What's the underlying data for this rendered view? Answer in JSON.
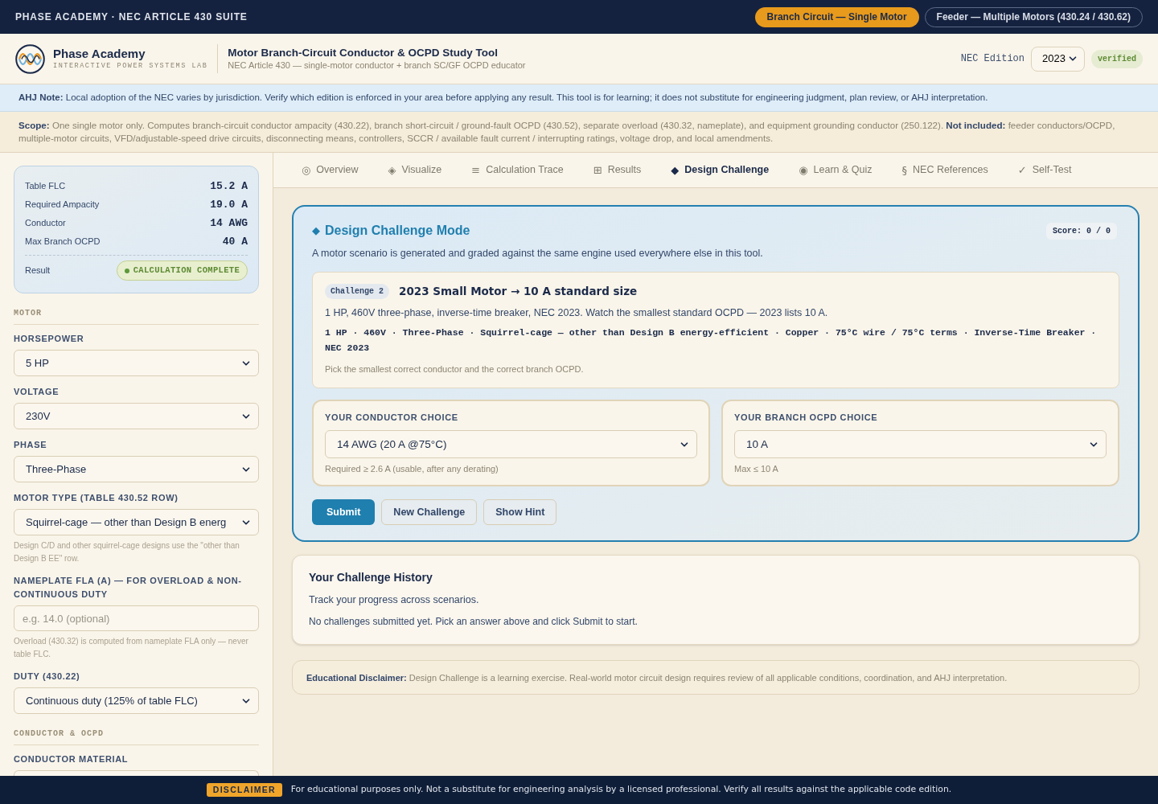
{
  "top_bar": {
    "title": "PHASE ACADEMY · NEC ARTICLE 430 SUITE",
    "modes": [
      {
        "label": "Branch Circuit — Single Motor",
        "selected": true
      },
      {
        "label": "Feeder — Multiple Motors (430.24 / 430.62)",
        "selected": false
      }
    ]
  },
  "header": {
    "brand": "Phase Academy",
    "tagline": "INTERACTIVE POWER SYSTEMS LAB",
    "title": "Motor Branch-Circuit Conductor & OCPD Study Tool",
    "subtitle": "NEC Article 430 — single-motor conductor + branch SC/GF OCPD educator",
    "edition_label": "NEC Edition",
    "edition": "2023",
    "edition_badge": "verified"
  },
  "ahj_note": "**AHJ Note:** Local adoption of the NEC varies by jurisdiction. Verify which edition is enforced in your area before applying any result. This tool is for learning; it does not substitute for engineering judgment, plan review, or AHJ interpretation.",
  "scope": "**Scope:** One single motor only. Computes branch-circuit conductor ampacity (430.22), branch short-circuit / ground-fault OCPD (430.52), separate overload (430.32, nameplate), and equipment grounding conductor (250.122). **Not included:** feeder conductors/OCPD, multiple-motor circuits, VFD/adjustable-speed drive circuits, disconnecting means, controllers, SCCR / available fault current / interrupting ratings, voltage drop, and local amendments.",
  "sidebar": {
    "summary": [
      {
        "label": "Table FLC",
        "value": "15.2 A"
      },
      {
        "label": "Required Ampacity",
        "value": "19.0 A"
      },
      {
        "label": "Conductor",
        "value": "14 AWG"
      },
      {
        "label": "Max Branch OCPD",
        "value": "40 A"
      }
    ],
    "result_label": "Result",
    "result_badge": "CALCULATION COMPLETE",
    "sections": [
      {
        "title": "MOTOR",
        "fields": [
          {
            "kind": "select",
            "label": "HORSEPOWER",
            "value": "5 HP"
          },
          {
            "kind": "select",
            "label": "VOLTAGE",
            "value": "230V"
          },
          {
            "kind": "select",
            "label": "PHASE",
            "value": "Three-Phase"
          },
          {
            "kind": "select",
            "label": "MOTOR TYPE (TABLE 430.52 ROW)",
            "value": "Squirrel-cage — other than Design B energ",
            "hint": "Design C/D and other squirrel-cage designs use the \"other than Design B EE\" row."
          },
          {
            "kind": "input",
            "label": "NAMEPLATE FLA (A) — FOR OVERLOAD & NON-CONTINUOUS DUTY",
            "placeholder": "e.g. 14.0 (optional)",
            "hint": "Overload (430.32) is computed from nameplate FLA only — never table FLC."
          },
          {
            "kind": "select",
            "label": "DUTY (430.22)",
            "value": "Continuous duty (125% of table FLC)"
          }
        ]
      },
      {
        "title": "CONDUCTOR & OCPD",
        "fields": [
          {
            "kind": "select",
            "label": "CONDUCTOR MATERIAL"
          }
        ]
      }
    ]
  },
  "tabs": [
    {
      "glyph": "◎",
      "label": "Overview",
      "selected": false
    },
    {
      "glyph": "◈",
      "label": "Visualize",
      "selected": false
    },
    {
      "glyph": "≡",
      "label": "Calculation Trace",
      "selected": false
    },
    {
      "glyph": "⊞",
      "label": "Results",
      "selected": false
    },
    {
      "glyph": "◆",
      "label": "Design Challenge",
      "selected": true
    },
    {
      "glyph": "◉",
      "label": "Learn & Quiz",
      "selected": false
    },
    {
      "glyph": "§",
      "label": "NEC References",
      "selected": false
    },
    {
      "glyph": "✓",
      "label": "Self-Test",
      "selected": false
    }
  ],
  "challenge": {
    "glyph": "◆",
    "title": "Design Challenge Mode",
    "score": "Score: 0 / 0",
    "description": "A motor scenario is generated and graded against the same engine used everywhere else in this tool.",
    "card": {
      "tag": "Challenge 2",
      "title": "2023 Small Motor → 10 A standard size",
      "summary": "1 HP, 460V three-phase, inverse-time breaker, NEC 2023. Watch the smallest standard OCPD — 2023 lists 10 A.",
      "params": "1 HP · 460V · Three-Phase · Squirrel-cage — other than Design B energy-efficient · Copper · 75°C wire / 75°C terms · Inverse-Time Breaker · NEC 2023",
      "prompt": "Pick the smallest correct conductor and the correct branch OCPD."
    },
    "choices": [
      {
        "label": "YOUR CONDUCTOR CHOICE",
        "value": "14 AWG (20 A @75°C)",
        "hint": "Required ≥ 2.6 A (usable, after any derating)"
      },
      {
        "label": "YOUR BRANCH OCPD CHOICE",
        "value": "10 A",
        "hint": "Max ≤ 10 A"
      }
    ],
    "buttons": [
      {
        "label": "Submit",
        "kind": "primary"
      },
      {
        "label": "New Challenge",
        "kind": "secondary"
      },
      {
        "label": "Show Hint",
        "kind": "secondary"
      }
    ]
  },
  "history": {
    "title": "Your Challenge History",
    "subtitle": "Track your progress across scenarios.",
    "empty": "No challenges submitted yet. Pick an answer above and click Submit to start."
  },
  "disclaimer_card": "**Educational Disclaimer:** Design Challenge is a learning exercise. Real-world motor circuit design requires review of all applicable conditions, coordination, and AHJ interpretation.",
  "footer": {
    "badge": "DISCLAIMER",
    "text": "For educational purposes only. Not a substitute for engineering analysis by a licensed professional. Verify all results against the applicable code edition."
  }
}
